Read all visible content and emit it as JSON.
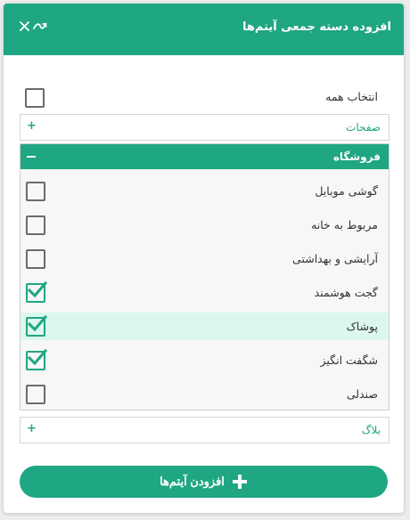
{
  "dialog": {
    "title": "افزوده دسته جمعی آیتم‌ها",
    "close_icon": "close-icon",
    "collapse_icon": "collapse-arrow-icon"
  },
  "select_all": {
    "label": "انتخاب همه",
    "checked": false
  },
  "panels": {
    "pages": {
      "title": "صفحات",
      "toggle": "+",
      "expanded": false
    },
    "shop": {
      "title": "فروشگاه",
      "toggle": "−",
      "expanded": true,
      "items": [
        {
          "label": "گوشی موبایل",
          "checked": false,
          "highlighted": false
        },
        {
          "label": "مربوط به خانه",
          "checked": false,
          "highlighted": false
        },
        {
          "label": "آرایشی و بهداشتی",
          "checked": false,
          "highlighted": false
        },
        {
          "label": "گجت هوشمند",
          "checked": true,
          "highlighted": false
        },
        {
          "label": "پوشاک",
          "checked": true,
          "highlighted": true
        },
        {
          "label": "شگفت انگیز",
          "checked": true,
          "highlighted": false
        },
        {
          "label": "صندلی",
          "checked": false,
          "highlighted": false
        }
      ]
    },
    "blog": {
      "title": "بلاگ",
      "toggle": "+",
      "expanded": false
    }
  },
  "add_button": {
    "label": "افزودن آیتم‌ها",
    "icon": "plus-icon"
  },
  "colors": {
    "accent": "#1fa682",
    "highlight_row": "#dcf8ee",
    "checkbox_border": "#6b6b6b"
  }
}
